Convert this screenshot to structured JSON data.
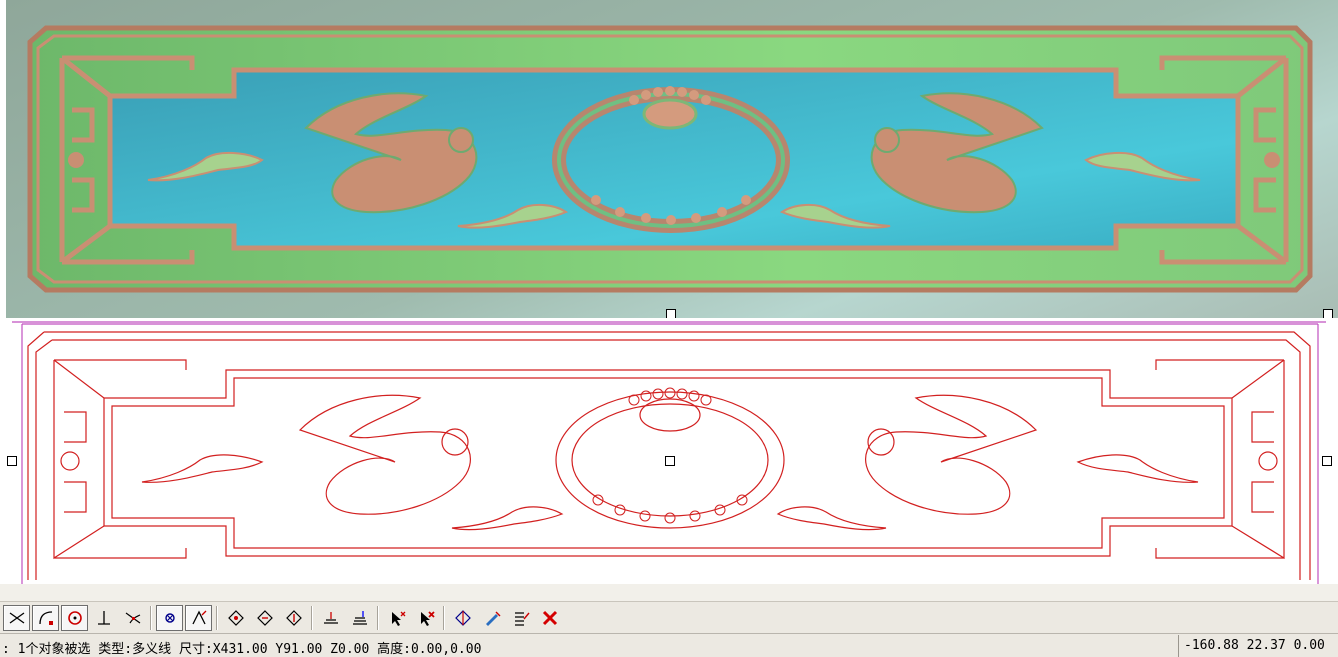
{
  "status": {
    "selection_text": ": 1个对象被选 类型:多义线 尺寸:X431.00 Y91.00 Z0.00 高度:0.00,0.00",
    "coordinates": "-160.88 22.37 0.00"
  },
  "toolbar": {
    "tools": [
      {
        "icon": "intersect-cross-icon",
        "active": true
      },
      {
        "icon": "arc-snap-icon",
        "active": true
      },
      {
        "icon": "circle-center-snap-icon",
        "active": true
      },
      {
        "icon": "perpendicular-snap-icon",
        "active": false
      },
      {
        "icon": "tangent-snap-icon",
        "active": false
      },
      {
        "icon": "grid-snap-icon",
        "active": true
      },
      {
        "icon": "angle-snap-icon",
        "active": true
      },
      {
        "icon": "diamond-node-icon",
        "active": false
      },
      {
        "icon": "diamond-edit-icon",
        "active": false
      },
      {
        "icon": "diamond-transform-icon",
        "active": false
      },
      {
        "icon": "layer-flat-icon",
        "active": false
      },
      {
        "icon": "layer-stack-icon",
        "active": false
      },
      {
        "icon": "select-pointer-icon",
        "active": false
      },
      {
        "icon": "deselect-pointer-icon",
        "active": false
      },
      {
        "icon": "mirror-node-icon",
        "active": false
      },
      {
        "icon": "pen-edit-icon",
        "active": false
      },
      {
        "icon": "list-edit-icon",
        "active": false
      },
      {
        "icon": "delete-x-icon",
        "active": false
      }
    ]
  },
  "colors": {
    "frame_green": "#86cf7e",
    "panel_blue": "#3fb6c8",
    "relief_copper": "#c98f73",
    "vector_red": "#d22020",
    "selection_magenta": "#c050c0"
  }
}
